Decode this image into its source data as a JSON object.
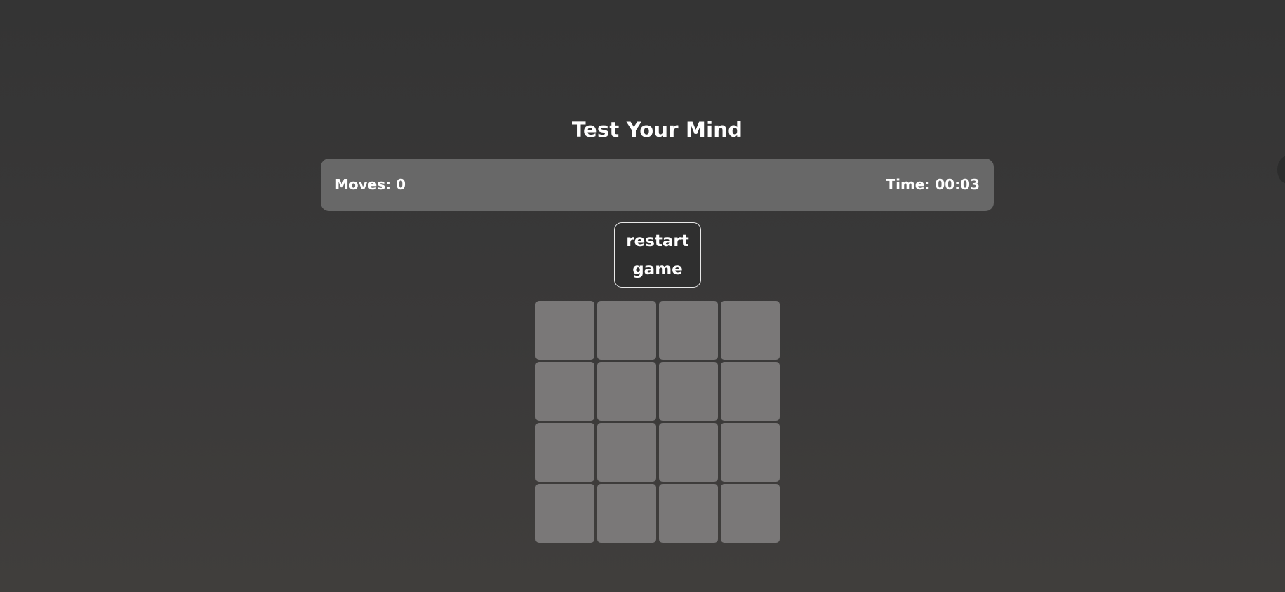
{
  "game": {
    "title": "Test Your Mind",
    "moves_text": "Moves: 0",
    "time_text": "Time: 00:03",
    "restart_line1": "restart",
    "restart_line2": "game"
  },
  "board": {
    "rows": 4,
    "columns": 4,
    "cards": [
      {
        "state": "face-down"
      },
      {
        "state": "face-down"
      },
      {
        "state": "face-down"
      },
      {
        "state": "face-down"
      },
      {
        "state": "face-down"
      },
      {
        "state": "face-down"
      },
      {
        "state": "face-down"
      },
      {
        "state": "face-down"
      },
      {
        "state": "face-down"
      },
      {
        "state": "face-down"
      },
      {
        "state": "face-down"
      },
      {
        "state": "face-down"
      },
      {
        "state": "face-down"
      },
      {
        "state": "face-down"
      },
      {
        "state": "face-down"
      },
      {
        "state": "face-down"
      }
    ]
  },
  "colors": {
    "background": "#363636",
    "stats_bar": "#686868",
    "card_back": "#7a7878",
    "button_bg": "#2f2f2f",
    "text": "#ffffff"
  }
}
